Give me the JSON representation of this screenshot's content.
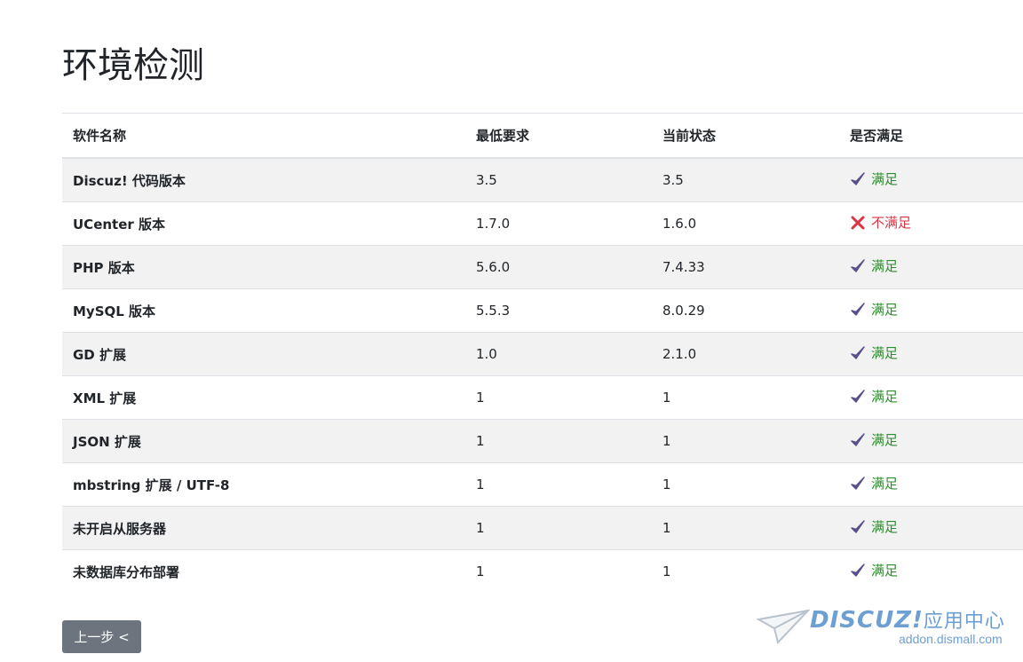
{
  "page": {
    "title": "环境检测"
  },
  "table": {
    "headers": [
      "软件名称",
      "最低要求",
      "当前状态",
      "是否满足"
    ],
    "rows": [
      {
        "name": "Discuz! 代码版本",
        "required": "3.5",
        "current": "3.5",
        "satisfied": "满足",
        "ok": true
      },
      {
        "name": "UCenter 版本",
        "required": "1.7.0",
        "current": "1.6.0",
        "satisfied": "不满足",
        "ok": false
      },
      {
        "name": "PHP 版本",
        "required": "5.6.0",
        "current": "7.4.33",
        "satisfied": "满足",
        "ok": true
      },
      {
        "name": "MySQL 版本",
        "required": "5.5.3",
        "current": "8.0.29",
        "satisfied": "满足",
        "ok": true
      },
      {
        "name": "GD 扩展",
        "required": "1.0",
        "current": "2.1.0",
        "satisfied": "满足",
        "ok": true
      },
      {
        "name": "XML 扩展",
        "required": "1",
        "current": "1",
        "satisfied": "满足",
        "ok": true
      },
      {
        "name": "JSON 扩展",
        "required": "1",
        "current": "1",
        "satisfied": "满足",
        "ok": true
      },
      {
        "name": "mbstring 扩展 / UTF-8",
        "required": "1",
        "current": "1",
        "satisfied": "满足",
        "ok": true
      },
      {
        "name": "未开启从服务器",
        "required": "1",
        "current": "1",
        "satisfied": "满足",
        "ok": true
      },
      {
        "name": "未数据库分布部署",
        "required": "1",
        "current": "1",
        "satisfied": "满足",
        "ok": true
      }
    ]
  },
  "actions": {
    "prev_label": "上一步 <"
  },
  "watermark": {
    "logo": "DISCUZ!",
    "logo_cn": "应用中心",
    "url": "addon.dismall.com"
  },
  "colors": {
    "ok_text": "#2e8b2e",
    "ok_icon": "#5b4e8c",
    "bad": "#dc3545",
    "button_bg": "#6c757d",
    "stripe": "#f2f2f2"
  },
  "icons": {
    "ok": "check-icon",
    "bad": "cross-icon"
  }
}
